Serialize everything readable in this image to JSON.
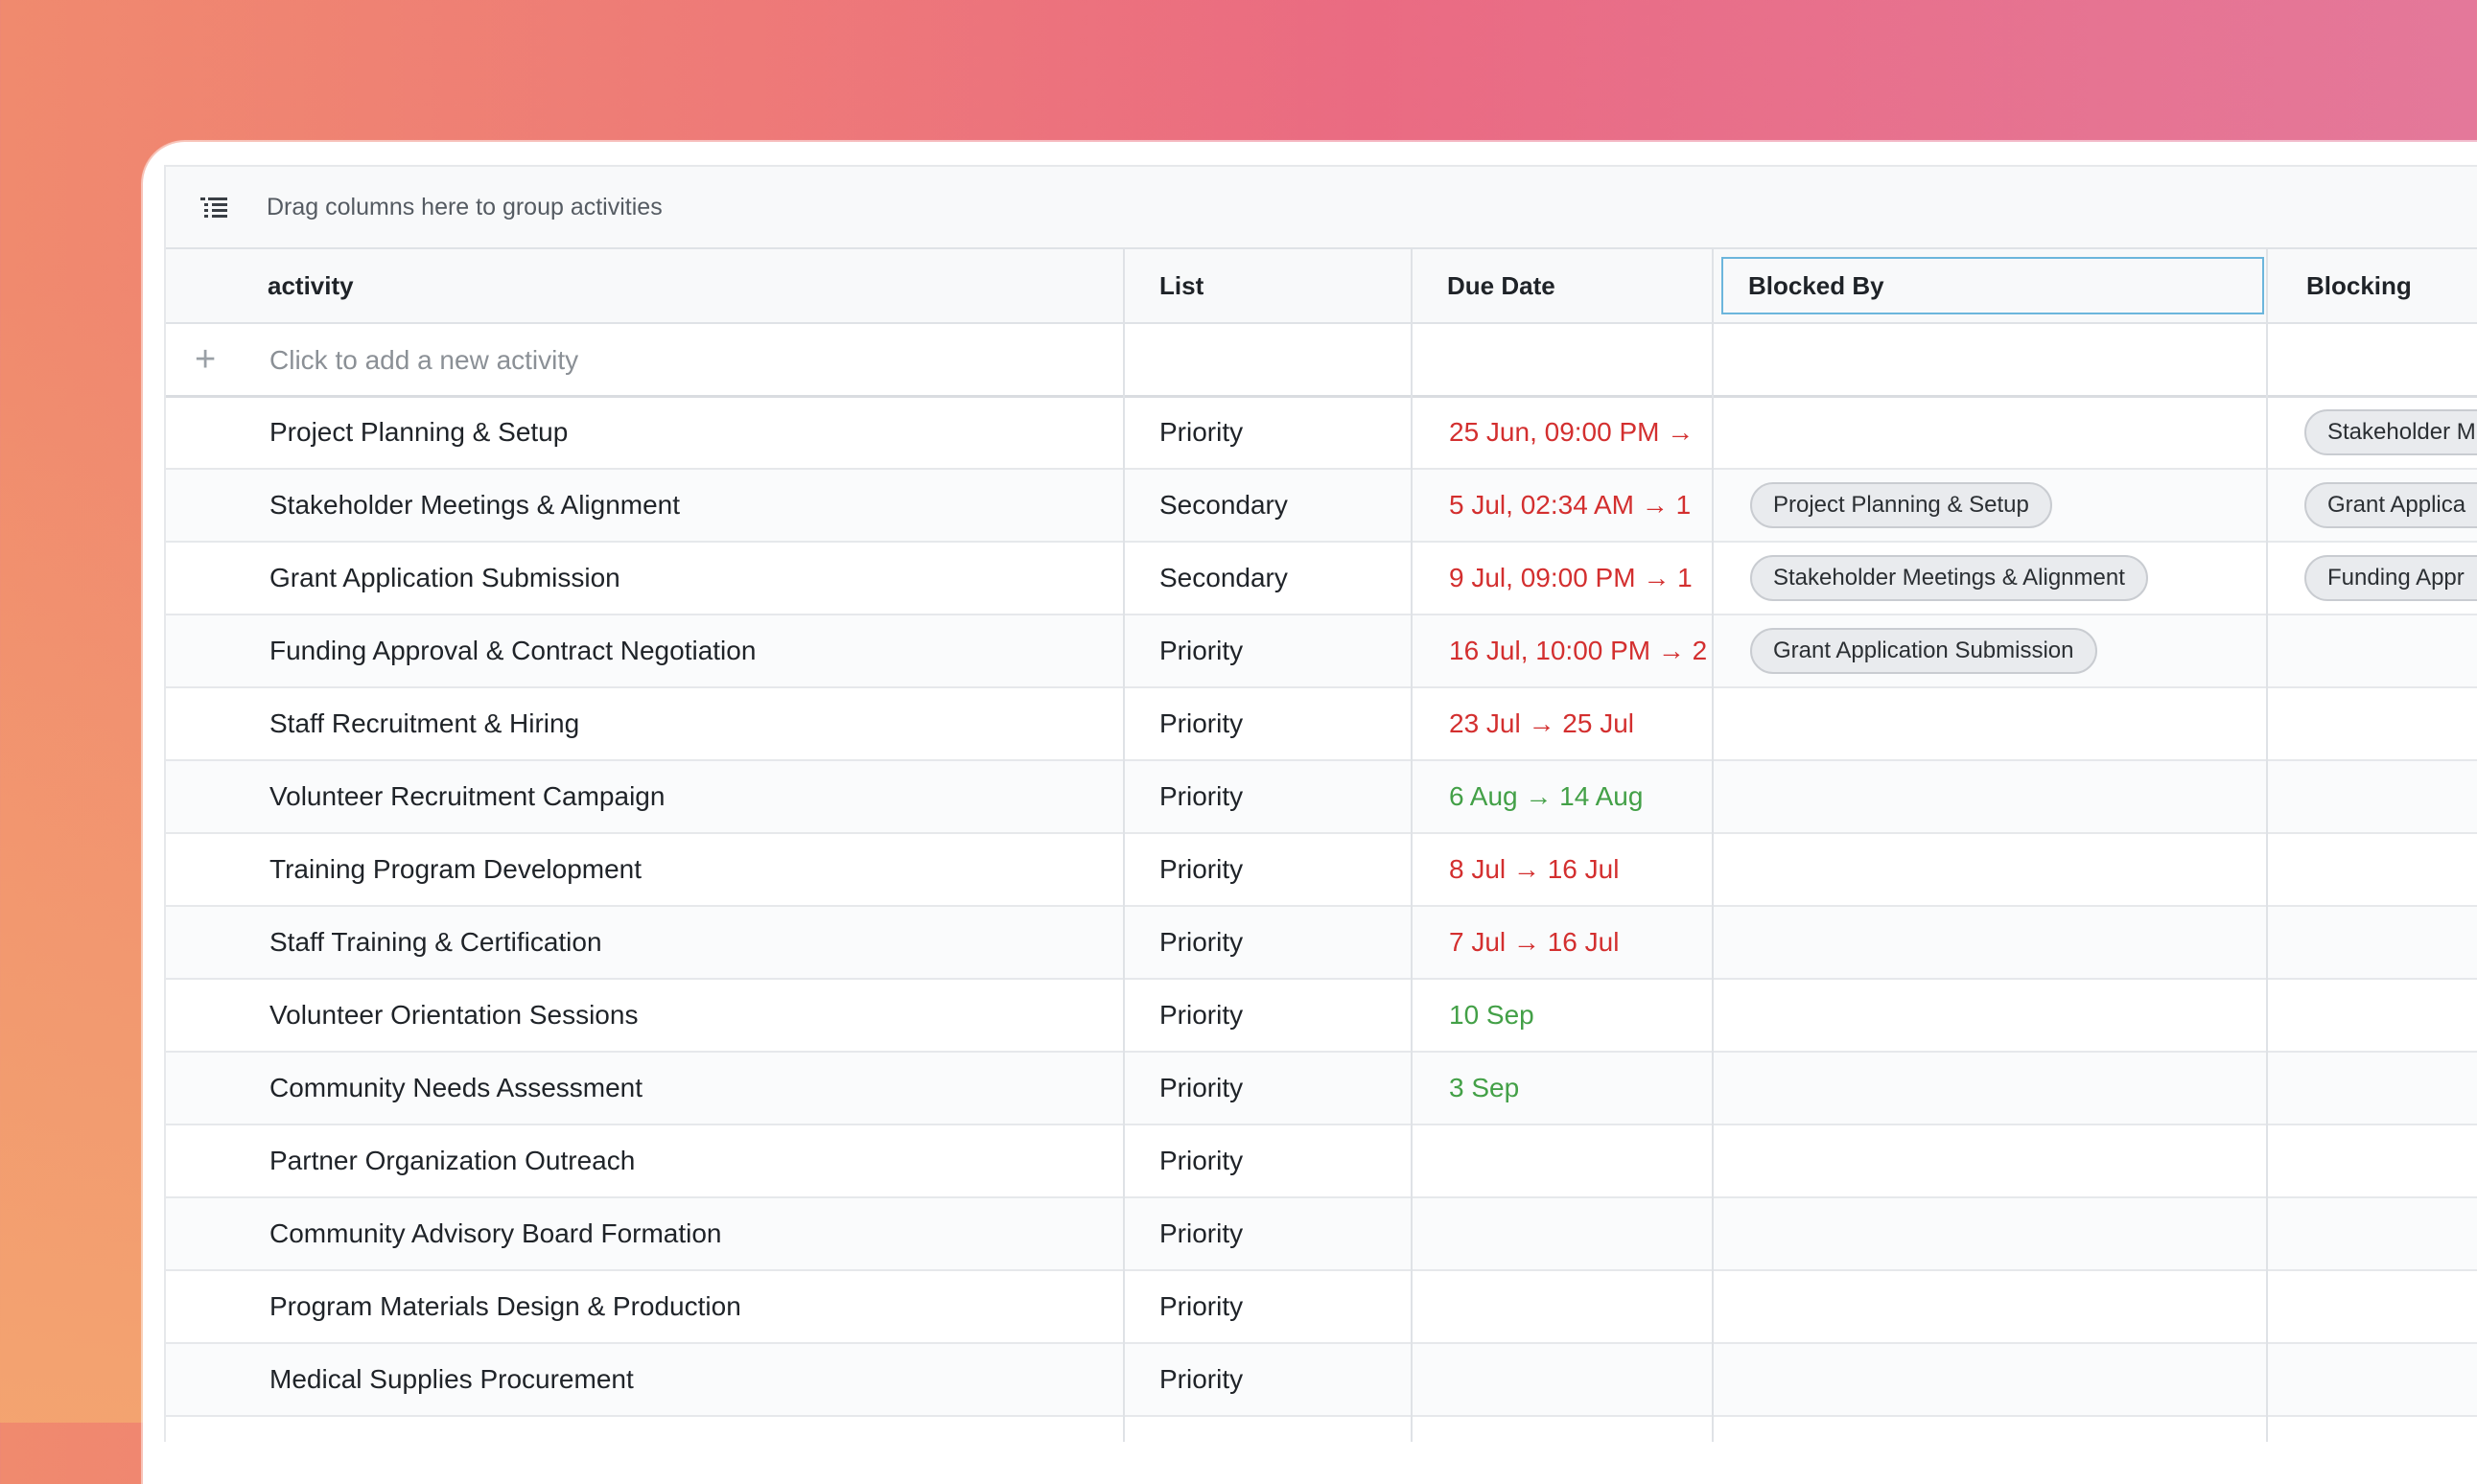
{
  "group_bar": {
    "text": "Drag columns here to group activities",
    "icon": "list-indent-icon"
  },
  "columns": {
    "activity": "activity",
    "list": "List",
    "due_date": "Due Date",
    "blocked_by": "Blocked By",
    "blocking": "Blocking"
  },
  "add_row": {
    "text": "Click to add a new activity"
  },
  "colors": {
    "overdue": "#d32f2f",
    "upcoming": "#43a047",
    "active_header_border": "#6cb6dc"
  },
  "rows": [
    {
      "activity": "Project Planning & Setup",
      "list": "Priority",
      "due": "25 Jun, 09:00 PM →",
      "due_status": "red",
      "blocked_by": "",
      "blocking": "Stakeholder M"
    },
    {
      "activity": "Stakeholder Meetings & Alignment",
      "list": "Secondary",
      "due": "5 Jul, 02:34 AM → 1",
      "due_status": "red",
      "blocked_by": "Project Planning & Setup",
      "blocking": "Grant Applica"
    },
    {
      "activity": "Grant Application Submission",
      "list": "Secondary",
      "due": "9 Jul, 09:00 PM → 1",
      "due_status": "red",
      "blocked_by": "Stakeholder Meetings & Alignment",
      "blocking": "Funding Appr"
    },
    {
      "activity": "Funding Approval & Contract Negotiation",
      "list": "Priority",
      "due": "16 Jul, 10:00 PM → 2",
      "due_status": "red",
      "blocked_by": "Grant Application Submission",
      "blocking": ""
    },
    {
      "activity": "Staff Recruitment & Hiring",
      "list": "Priority",
      "due": "23 Jul → 25 Jul",
      "due_status": "red",
      "blocked_by": "",
      "blocking": ""
    },
    {
      "activity": "Volunteer Recruitment Campaign",
      "list": "Priority",
      "due": "6 Aug → 14 Aug",
      "due_status": "green",
      "blocked_by": "",
      "blocking": ""
    },
    {
      "activity": "Training Program Development",
      "list": "Priority",
      "due": "8 Jul → 16 Jul",
      "due_status": "red",
      "blocked_by": "",
      "blocking": ""
    },
    {
      "activity": "Staff Training & Certification",
      "list": "Priority",
      "due": "7 Jul → 16 Jul",
      "due_status": "red",
      "blocked_by": "",
      "blocking": ""
    },
    {
      "activity": "Volunteer Orientation Sessions",
      "list": "Priority",
      "due": "10 Sep",
      "due_status": "green",
      "blocked_by": "",
      "blocking": ""
    },
    {
      "activity": "Community Needs Assessment",
      "list": "Priority",
      "due": "3 Sep",
      "due_status": "green",
      "blocked_by": "",
      "blocking": ""
    },
    {
      "activity": "Partner Organization Outreach",
      "list": "Priority",
      "due": "",
      "due_status": "",
      "blocked_by": "",
      "blocking": ""
    },
    {
      "activity": "Community Advisory Board Formation",
      "list": "Priority",
      "due": "",
      "due_status": "",
      "blocked_by": "",
      "blocking": ""
    },
    {
      "activity": "Program Materials Design & Production",
      "list": "Priority",
      "due": "",
      "due_status": "",
      "blocked_by": "",
      "blocking": ""
    },
    {
      "activity": "Medical Supplies Procurement",
      "list": "Priority",
      "due": "",
      "due_status": "",
      "blocked_by": "",
      "blocking": ""
    }
  ]
}
